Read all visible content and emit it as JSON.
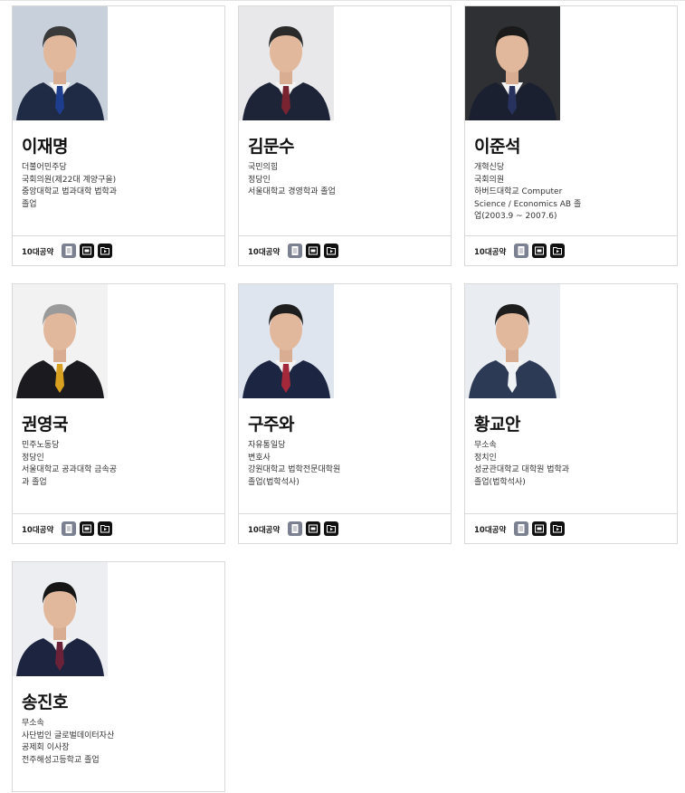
{
  "pledge_label": "10대공약",
  "candidates": [
    {
      "name": "이재명",
      "info": [
        "더불어민주당",
        "국회의원(제22대 계양구을)",
        "중앙대학교 법과대학 법학과",
        "졸업"
      ],
      "photo": {
        "bg": "#c8d0dc",
        "suit": "#1f2a44",
        "tie": "#1d3d8f",
        "hair": "#3a3a3a"
      }
    },
    {
      "name": "김문수",
      "info": [
        "국민의힘",
        "정당인",
        "서울대학교 경영학과 졸업"
      ],
      "photo": {
        "bg": "#e8e8ea",
        "suit": "#1d2438",
        "tie": "#7a2330",
        "hair": "#2a2a2a"
      }
    },
    {
      "name": "이준석",
      "info": [
        "개혁신당",
        "국회의원",
        "하버드대학교 Computer",
        "Science / Economics AB 졸",
        "업(2003.9 ~ 2007.6)"
      ],
      "photo": {
        "bg": "#2f3033",
        "suit": "#1b2030",
        "tie": "#27325e",
        "hair": "#1a1a1a"
      }
    },
    {
      "name": "권영국",
      "info": [
        "민주노동당",
        "정당인",
        "서울대학교 공과대학 금속공",
        "과 졸업"
      ],
      "photo": {
        "bg": "#f2f2f2",
        "suit": "#1a1a1f",
        "tie": "#d9a020",
        "hair": "#9a9a9a"
      }
    },
    {
      "name": "구주와",
      "info": [
        "자유통일당",
        "변호사",
        "강원대학교 법학전문대학원",
        "졸업(법학석사)"
      ],
      "photo": {
        "bg": "#dfe5ee",
        "suit": "#1c2542",
        "tie": "#a3283a",
        "hair": "#1e1e1e"
      }
    },
    {
      "name": "황교안",
      "info": [
        "무소속",
        "정치인",
        "성균관대학교 대학원 법학과",
        "졸업(법학석사)"
      ],
      "photo": {
        "bg": "#e9ecf0",
        "suit": "#2d3a55",
        "tie": "#eef1f5",
        "hair": "#1d1d1d"
      }
    },
    {
      "name": "송진호",
      "info": [
        "무소속",
        "사단법인 글로벌데이터자산",
        "공제회 이사장",
        "전주해성고등학교 졸업"
      ],
      "photo": {
        "bg": "#eceef1",
        "suit": "#1c2440",
        "tie": "#6b2238",
        "hair": "#161616"
      }
    }
  ]
}
